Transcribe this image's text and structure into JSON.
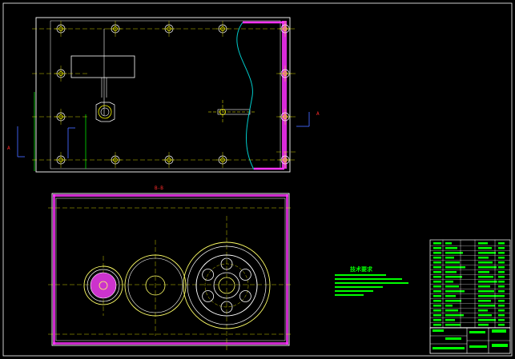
{
  "drawing": {
    "section_label": "B-B",
    "view_marker_left": "A",
    "view_marker_right": "A",
    "tech_requirements_title": "技术要求"
  },
  "colors": {
    "background": "#000000",
    "outline": "#ffffff",
    "center_line": "#ffff00",
    "hatch": "#ff33ff",
    "cut_line": "#00cccc",
    "dimension": "#00ff00",
    "marker": "#ff2a2a",
    "gear": "#ffff66"
  }
}
